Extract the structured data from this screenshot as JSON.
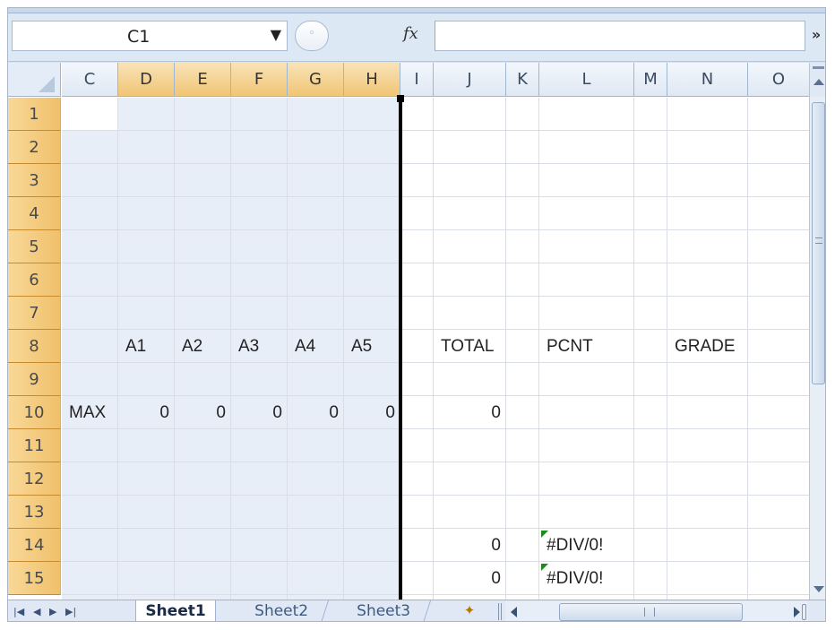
{
  "name_box": {
    "value": "C1"
  },
  "formula_bar": {
    "fx_label": "fx",
    "content": ""
  },
  "columns": [
    "C",
    "D",
    "E",
    "F",
    "G",
    "H",
    "I",
    "J",
    "K",
    "L",
    "M",
    "N",
    "O"
  ],
  "selected_columns": [
    "D",
    "E",
    "F",
    "G",
    "H"
  ],
  "rows": [
    "1",
    "2",
    "3",
    "4",
    "5",
    "6",
    "7",
    "8",
    "9",
    "10",
    "11",
    "12",
    "13",
    "14",
    "15"
  ],
  "cells": [
    {
      "ref": "D8",
      "value": "A1"
    },
    {
      "ref": "E8",
      "value": "A2"
    },
    {
      "ref": "F8",
      "value": "A3"
    },
    {
      "ref": "G8",
      "value": "A4"
    },
    {
      "ref": "H8",
      "value": "A5"
    },
    {
      "ref": "J8",
      "value": "TOTAL"
    },
    {
      "ref": "L8",
      "value": "PCNT"
    },
    {
      "ref": "N8",
      "value": "GRADE"
    },
    {
      "ref": "C10",
      "value": "MAX"
    },
    {
      "ref": "D10",
      "value": "0"
    },
    {
      "ref": "E10",
      "value": "0"
    },
    {
      "ref": "F10",
      "value": "0"
    },
    {
      "ref": "G10",
      "value": "0"
    },
    {
      "ref": "H10",
      "value": "0"
    },
    {
      "ref": "J10",
      "value": "0"
    },
    {
      "ref": "J14",
      "value": "0"
    },
    {
      "ref": "L14",
      "value": "#DIV/0!"
    },
    {
      "ref": "J15",
      "value": "0"
    },
    {
      "ref": "L15",
      "value": "#DIV/0!"
    }
  ],
  "sheet_tabs": [
    {
      "label": "Sheet1",
      "active": true
    },
    {
      "label": "Sheet2",
      "active": false
    },
    {
      "label": "Sheet3",
      "active": false
    }
  ],
  "icons": {
    "dropdown": "chevron-down-icon",
    "fx": "function-icon",
    "expand": "double-chevron-down-icon",
    "insert_sheet": "insert-worksheet-icon"
  },
  "colors": {
    "row_header": "#f0c06a",
    "selected_column_header": "#f1c574",
    "selection_fill": "#e8eef8",
    "error_marker": "#1d8a1d"
  }
}
